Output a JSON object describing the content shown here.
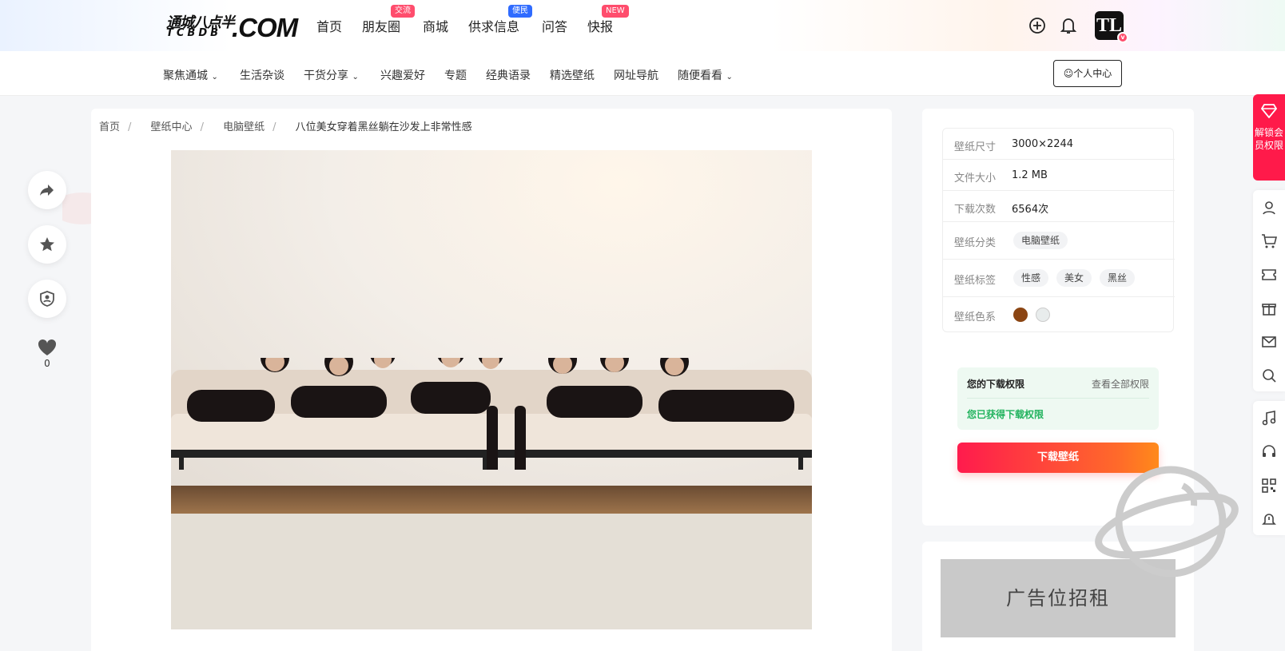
{
  "header": {
    "logo": {
      "zh": "通城八点半",
      "en": "TCBDB",
      "com": ".COM"
    },
    "nav": [
      {
        "label": "首页",
        "badge": ""
      },
      {
        "label": "朋友圈",
        "badge": "交流",
        "badge_color": "#ff4d6d"
      },
      {
        "label": "商城",
        "badge": ""
      },
      {
        "label": "供求信息",
        "badge": "便民",
        "badge_color": "#2f6bff"
      },
      {
        "label": "问答",
        "badge": ""
      },
      {
        "label": "快报",
        "badge": "NEW",
        "badge_color": "#ff4d6d"
      }
    ],
    "icons": [
      "add-circle-icon",
      "bell-icon"
    ],
    "avatar_text": "TL",
    "avatar_badge": "v"
  },
  "subnav": {
    "items": [
      {
        "label": "聚焦通城",
        "dropdown": true
      },
      {
        "label": "生活杂谈",
        "dropdown": false
      },
      {
        "label": "干货分享",
        "dropdown": true
      },
      {
        "label": "兴趣爱好",
        "dropdown": false
      },
      {
        "label": "专题",
        "dropdown": false
      },
      {
        "label": "经典语录",
        "dropdown": false
      },
      {
        "label": "精选壁纸",
        "dropdown": false
      },
      {
        "label": "网址导航",
        "dropdown": false
      },
      {
        "label": "随便看看",
        "dropdown": true
      }
    ],
    "user_center": "个人中心"
  },
  "left_actions": {
    "icons": [
      "share-icon",
      "star-icon",
      "shield-user-icon",
      "heart-icon"
    ],
    "like_count": "0"
  },
  "breadcrumb": {
    "items": [
      "首页",
      "壁纸中心",
      "电脑壁纸"
    ],
    "separator": "/",
    "current": "八位美女穿着黑丝躺在沙发上非常性感"
  },
  "info": {
    "size_label": "壁纸尺寸",
    "size_value": "3000×2244",
    "file_label": "文件大小",
    "file_value": "1.2 MB",
    "downloads_label": "下载次数",
    "downloads_value": "6564次",
    "category_label": "壁纸分类",
    "category_value": "电脑壁纸",
    "tags_label": "壁纸标签",
    "tags": [
      "性感",
      "美女",
      "黑丝"
    ],
    "colors_label": "壁纸色系",
    "colors": [
      "#8b4513",
      "#e8ecec"
    ]
  },
  "permission": {
    "title": "您的下载权限",
    "link": "查看全部权限",
    "status": "您已获得下载权限"
  },
  "download_button": "下载壁纸",
  "ad_text": "广告位招租",
  "right_sidebar": {
    "vip_label": "解锁会员权限",
    "icons_group1": [
      "user-icon",
      "cart-icon",
      "ticket-icon",
      "gift-icon",
      "mail-icon",
      "search-icon"
    ],
    "icons_group2": [
      "music-icon",
      "headset-icon",
      "qrcode-icon",
      "bell-alert-icon"
    ]
  }
}
